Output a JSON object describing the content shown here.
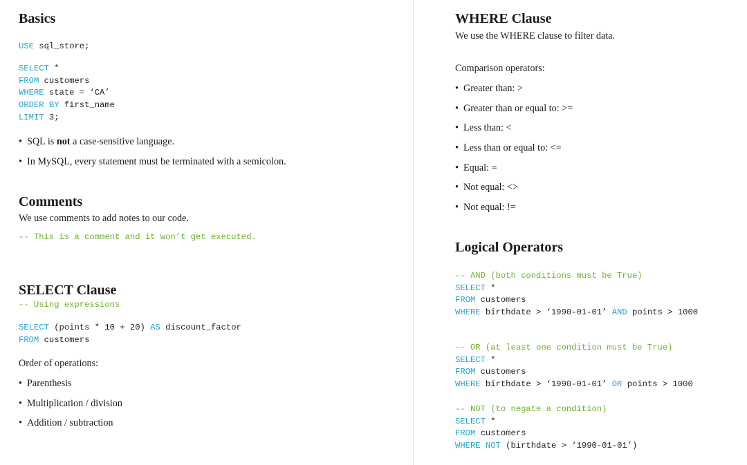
{
  "basics": {
    "title": "Basics",
    "use_kw": "USE",
    "use_rest": " sql_store;",
    "select_kw": "SELECT",
    "select_rest": " *",
    "from_kw": "FROM",
    "from_rest": " customers",
    "where_kw": "WHERE",
    "where_rest": " state = ‘CA’",
    "order_kw": "ORDER BY",
    "order_rest": " first_name",
    "limit_kw": "LIMIT",
    "limit_rest": " 3;",
    "bullet1_pre": "SQL is ",
    "bullet1_bold": "not",
    "bullet1_post": " a case-sensitive language.",
    "bullet2": "In MySQL, every statement must be terminated with a semicolon."
  },
  "comments": {
    "title": "Comments",
    "text": "We use comments to add notes to our code.",
    "example": "–- This is a comment and it won’t get executed."
  },
  "select_clause": {
    "title": "SELECT Clause",
    "comment": "–- Using expressions",
    "select_kw": "SELECT",
    "select_mid": " (points * 10 + 20) ",
    "as_kw": "AS",
    "select_end": " discount_factor",
    "from_kw": "FROM",
    "from_rest": " customers",
    "order_heading": "Order of operations:",
    "ops": [
      "Parenthesis",
      "Multiplication / division",
      "Addition / subtraction"
    ]
  },
  "where_clause": {
    "title": "WHERE Clause",
    "text": "We use the WHERE clause to filter data.",
    "comparison_heading": "Comparison operators:",
    "operators": [
      "Greater than: >",
      "Greater than or equal to: >=",
      "Less than: <",
      "Less than or equal to: <=",
      "Equal: =",
      "Not equal: <>",
      "Not equal: !="
    ]
  },
  "logical": {
    "title": "Logical Operators",
    "and_comment": "–- AND (both conditions must be True)",
    "or_comment": "–- OR (at least one condition must be True)",
    "not_comment": "–- NOT (to negate a condition)",
    "select_kw": "SELECT",
    "select_rest": " *",
    "from_kw": "FROM",
    "from_rest": " customers",
    "where_kw": "WHERE",
    "and_cond1": " birthdate > ‘1990-01-01’ ",
    "and_kw": "AND",
    "and_cond2": " points > 1000",
    "or_cond1": " birthdate > ‘1990-01-01’ ",
    "or_kw": "OR",
    "or_cond2": " points > 1000",
    "not_kw": "NOT",
    "not_cond": " (birthdate > ‘1990-01-01’)"
  }
}
